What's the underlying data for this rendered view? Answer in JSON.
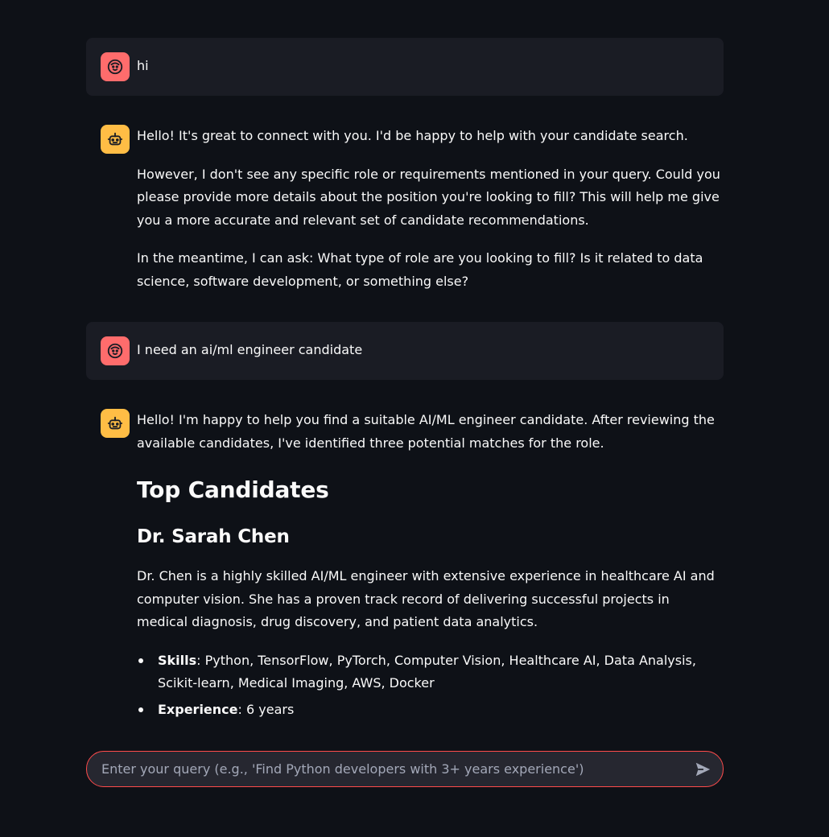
{
  "messages": [
    {
      "role": "user",
      "text": "hi"
    },
    {
      "role": "assistant",
      "paragraphs": [
        "Hello! It's great to connect with you. I'd be happy to help with your candidate search.",
        "However, I don't see any specific role or requirements mentioned in your query. Could you please provide more details about the position you're looking to fill? This will help me give you a more accurate and relevant set of candidate recommendations.",
        "In the meantime, I can ask: What type of role are you looking to fill? Is it related to data science, software development, or something else?"
      ]
    },
    {
      "role": "user",
      "text": "I need an ai/ml engineer candidate"
    },
    {
      "role": "assistant",
      "intro": "Hello! I'm happy to help you find a suitable AI/ML engineer candidate. After reviewing the available candidates, I've identified three potential matches for the role.",
      "heading": "Top Candidates",
      "candidate": {
        "name": "Dr. Sarah Chen",
        "summary": "Dr. Chen is a highly skilled AI/ML engineer with extensive experience in healthcare AI and computer vision. She has a proven track record of delivering successful projects in medical diagnosis, drug discovery, and patient data analytics.",
        "details": [
          {
            "label": "Skills",
            "value": ": Python, TensorFlow, PyTorch, Computer Vision, Healthcare AI, Data Analysis, Scikit-learn, Medical Imaging, AWS, Docker"
          },
          {
            "label": "Experience",
            "value": ": 6 years"
          }
        ]
      }
    }
  ],
  "chat_input": {
    "placeholder": "Enter your query (e.g., 'Find Python developers with 3+ years experience')"
  },
  "icons": {
    "user_avatar": "smiley-face-icon",
    "assistant_avatar": "robot-icon",
    "send": "send-arrow-icon"
  },
  "colors": {
    "background": "#0e1117",
    "user_message_bg": "#1a1c24",
    "user_avatar": "#ff6c6c",
    "assistant_avatar": "#ffbd45",
    "input_border": "#ff4b4b"
  }
}
